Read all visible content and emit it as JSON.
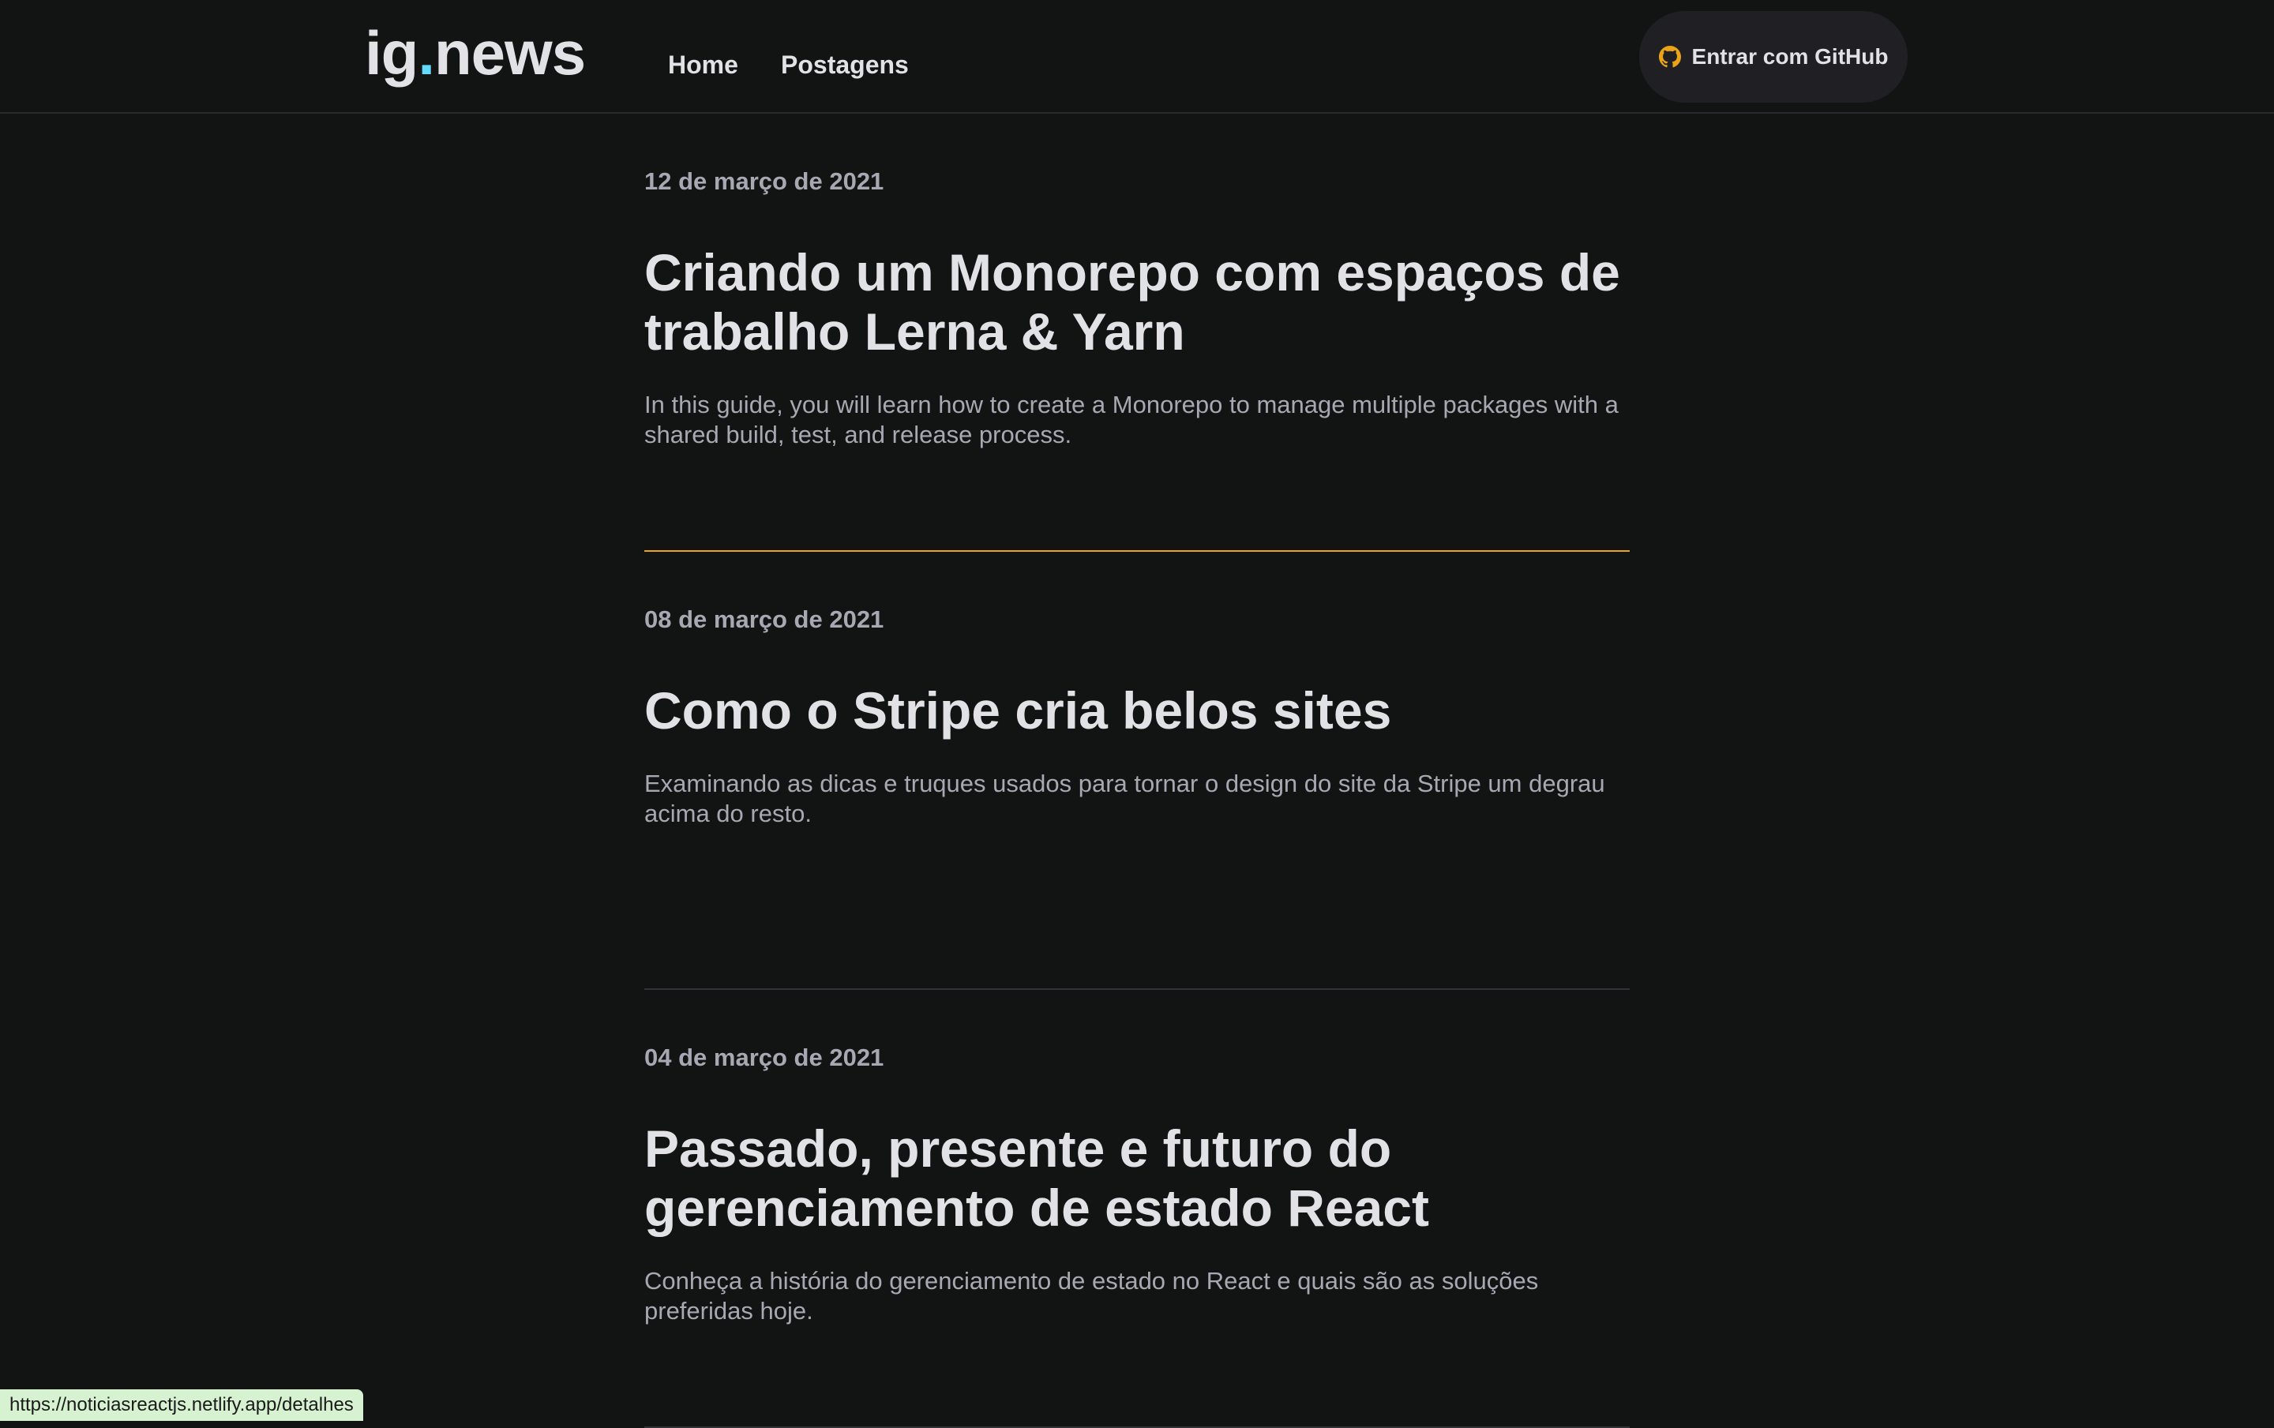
{
  "header": {
    "logo": {
      "prefix": "ig",
      "dot": ".",
      "suffix": "news"
    },
    "nav": [
      {
        "label": "Home"
      },
      {
        "label": "Postagens"
      }
    ],
    "login_label": "Entrar com GitHub",
    "login_icon": "github-icon",
    "accent_color": "#eba417",
    "logo_dot_color": "#61dafb"
  },
  "posts": [
    {
      "date": "12 de março de 2021",
      "title": "Criando um Monorepo com espaços de trabalho Lerna & Yarn",
      "excerpt": "In this guide, you will learn how to create a Monorepo to manage multiple packages with a shared build, test, and release process.",
      "hovered": true
    },
    {
      "date": "08 de março de 2021",
      "title": "Como o Stripe cria belos sites",
      "excerpt": "Examinando as dicas e truques usados para tornar o design do site da Stripe um degrau acima do resto.",
      "hovered": false
    },
    {
      "date": "04 de março de 2021",
      "title": "Passado, presente e futuro do gerenciamento de estado React",
      "excerpt": "Conheça a história do gerenciamento de estado no React e quais são as soluções preferidas hoje.",
      "hovered": false
    }
  ],
  "status_bar": {
    "url": "https://noticiasreactjs.netlify.app/detalhes"
  }
}
